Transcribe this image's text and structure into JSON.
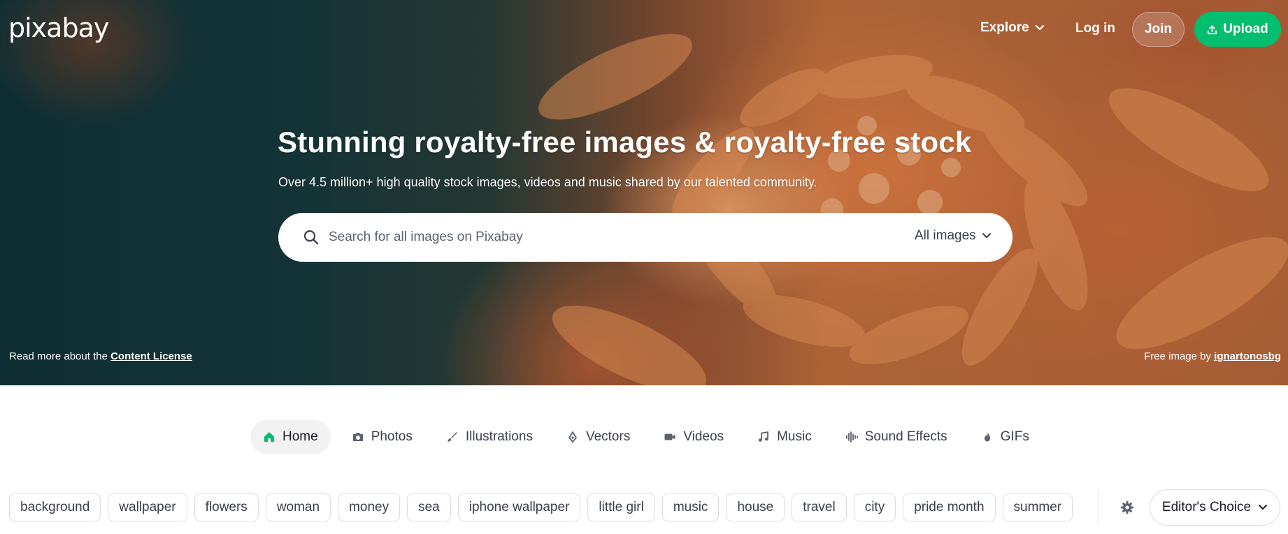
{
  "brand": {
    "logo_text": "pixabay"
  },
  "nav": {
    "explore_label": "Explore",
    "login_label": "Log in",
    "join_label": "Join",
    "upload_label": "Upload"
  },
  "hero": {
    "title": "Stunning royalty-free images & royalty-free stock",
    "subtitle": "Over 4.5 million+ high quality stock images, videos and music shared by our talented community.",
    "license_prefix": "Read more about the ",
    "license_link": "Content License",
    "credit_prefix": "Free image by ",
    "credit_author": "ignartonosbg"
  },
  "search": {
    "placeholder": "Search for all images on Pixabay",
    "value": "",
    "type_label": "All images"
  },
  "tabs": [
    {
      "label": "Home",
      "icon": "home-icon",
      "active": true
    },
    {
      "label": "Photos",
      "icon": "camera-icon"
    },
    {
      "label": "Illustrations",
      "icon": "brush-icon"
    },
    {
      "label": "Vectors",
      "icon": "pen-nib-icon"
    },
    {
      "label": "Videos",
      "icon": "video-camera-icon"
    },
    {
      "label": "Music",
      "icon": "music-note-icon"
    },
    {
      "label": "Sound Effects",
      "icon": "sound-wave-icon"
    },
    {
      "label": "GIFs",
      "icon": "flame-icon"
    }
  ],
  "tags": [
    "background",
    "wallpaper",
    "flowers",
    "woman",
    "money",
    "sea",
    "iphone wallpaper",
    "little girl",
    "music",
    "house",
    "travel",
    "city",
    "pride month",
    "summer"
  ],
  "filter": {
    "sort_label": "Editor's Choice"
  },
  "colors": {
    "accent": "#02be6e",
    "home_icon": "#02be6e"
  }
}
